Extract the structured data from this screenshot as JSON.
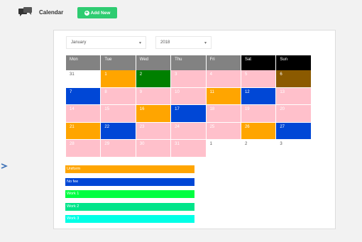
{
  "header": {
    "title": "Calendar",
    "add_button_label": "Add New",
    "calendar_icon": "calendar-chat-icon"
  },
  "filters": {
    "month": "January",
    "year": "2018"
  },
  "colors": {
    "header_gray": "#828282",
    "header_black": "#000000",
    "pink": "#ffc0cb",
    "orange": "#ffa500",
    "green": "#008000",
    "blue": "#0047d6",
    "brown": "#8b5a00",
    "white": "#ffffff",
    "btn_green": "#2ecc71"
  },
  "calendar": {
    "weekdays": [
      "Mon",
      "Tue",
      "Wed",
      "Thu",
      "Fri",
      "Sat",
      "Sun"
    ],
    "weeks": [
      [
        {
          "day": "31",
          "color": "white",
          "out": true
        },
        {
          "day": "1",
          "color": "orange"
        },
        {
          "day": "2",
          "color": "green"
        },
        {
          "day": "3",
          "color": "pink"
        },
        {
          "day": "4",
          "color": "pink"
        },
        {
          "day": "5",
          "color": "pink"
        },
        {
          "day": "6",
          "color": "brown"
        }
      ],
      [
        {
          "day": "7",
          "color": "blue"
        },
        {
          "day": "8",
          "color": "pink"
        },
        {
          "day": "9",
          "color": "pink"
        },
        {
          "day": "10",
          "color": "pink"
        },
        {
          "day": "11",
          "color": "orange"
        },
        {
          "day": "12",
          "color": "blue"
        },
        {
          "day": "13",
          "color": "pink"
        }
      ],
      [
        {
          "day": "14",
          "color": "pink"
        },
        {
          "day": "15",
          "color": "pink"
        },
        {
          "day": "16",
          "color": "orange"
        },
        {
          "day": "17",
          "color": "blue"
        },
        {
          "day": "18",
          "color": "pink"
        },
        {
          "day": "19",
          "color": "pink"
        },
        {
          "day": "20",
          "color": "pink"
        }
      ],
      [
        {
          "day": "21",
          "color": "orange"
        },
        {
          "day": "22",
          "color": "blue"
        },
        {
          "day": "23",
          "color": "pink"
        },
        {
          "day": "24",
          "color": "pink"
        },
        {
          "day": "25",
          "color": "pink"
        },
        {
          "day": "26",
          "color": "orange"
        },
        {
          "day": "27",
          "color": "blue"
        }
      ],
      [
        {
          "day": "28",
          "color": "pink"
        },
        {
          "day": "29",
          "color": "pink"
        },
        {
          "day": "30",
          "color": "pink"
        },
        {
          "day": "31",
          "color": "pink"
        },
        {
          "day": "1",
          "color": "white",
          "out": true
        },
        {
          "day": "2",
          "color": "white",
          "out": true
        },
        {
          "day": "3",
          "color": "white",
          "out": true
        }
      ]
    ]
  },
  "legend": [
    {
      "label": "Uniform",
      "color": "#ffa500"
    },
    {
      "label": "No fee",
      "color": "#0047d6"
    },
    {
      "label": "Work 1",
      "color": "#00ff40"
    },
    {
      "label": "Work 2",
      "color": "#00e58a"
    },
    {
      "label": "Work 3",
      "color": "#00ffe6"
    }
  ]
}
